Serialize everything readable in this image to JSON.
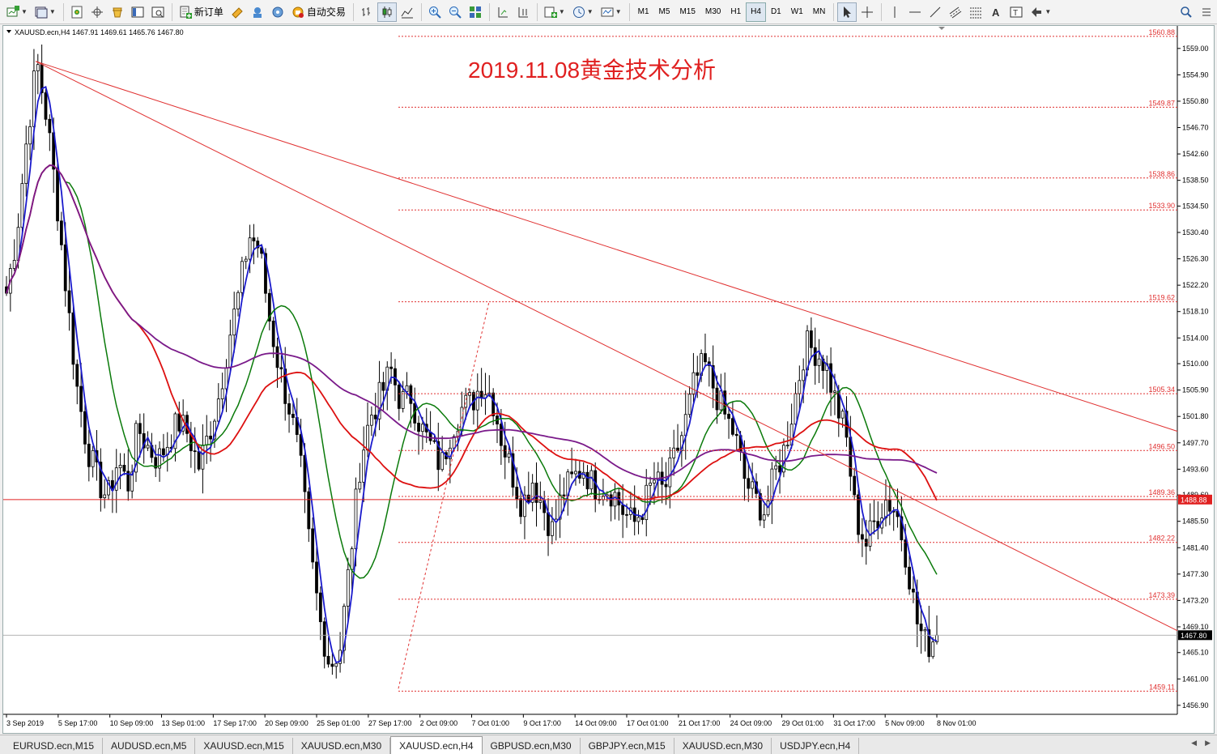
{
  "window": {
    "title": "XAUUSD.ecn,H4"
  },
  "toolbar": {
    "new_order_label": "新订单",
    "autotrade_label": "自动交易",
    "timeframes": [
      "M1",
      "M5",
      "M15",
      "M30",
      "H1",
      "H4",
      "D1",
      "W1",
      "MN"
    ],
    "active_timeframe": "H4",
    "icons": [
      "new-chart-icon",
      "profiles-icon",
      "market-watch-icon",
      "navigator-icon",
      "data-window-icon",
      "terminal-icon",
      "strategy-tester-icon",
      "new-order-icon",
      "metaeditor-icon",
      "metaquotes-icon",
      "signals-icon",
      "autotrade-icon",
      "bar-chart-icon",
      "candles-icon",
      "line-chart-icon",
      "zoom-in-icon",
      "zoom-out-icon",
      "tile-icon",
      "autoscroll-icon",
      "chart-shift-icon",
      "indicators-icon",
      "period-icon",
      "templates-icon",
      "cursor-icon",
      "crosshair-icon",
      "vertical-line-icon",
      "horizontal-line-icon",
      "trendline-icon",
      "equidistant-channel-icon",
      "fibonacci-icon",
      "text-icon",
      "text-label-icon",
      "arrows-icon",
      "search-icon"
    ],
    "accent": "#1e5fb4"
  },
  "chart": {
    "header": "XAUUSD.ecn,H4  1467.91 1469.61 1465.76 1467.80",
    "annotation": "2019.11.08黄金技术分析",
    "annotation_color": "#e02020",
    "current_price": "1467.80",
    "hline_price": "1488.88",
    "colors": {
      "bg": "#ffffff",
      "candle": "#000000",
      "ma_fast": "#1a1acc",
      "ma_mid": "#0a7a0a",
      "ma_slow": "#dd1010",
      "ma_long": "#7a1a8a",
      "level": "#e03030",
      "price_tag": "#e02020"
    }
  },
  "chart_data": {
    "type": "candlestick",
    "symbol": "XAUUSD.ecn",
    "timeframe": "H4",
    "ohlc": {
      "open": 1467.91,
      "high": 1469.61,
      "low": 1465.76,
      "close": 1467.8
    },
    "ylim": [
      1455.5,
      1562.5
    ],
    "yticks": [
      "1559.00",
      "1554.90",
      "1550.80",
      "1546.70",
      "1542.60",
      "1538.50",
      "1534.50",
      "1530.40",
      "1526.30",
      "1522.20",
      "1518.10",
      "1514.00",
      "1510.00",
      "1505.90",
      "1501.80",
      "1497.70",
      "1493.60",
      "1489.60",
      "1485.50",
      "1481.40",
      "1477.30",
      "1473.20",
      "1469.10",
      "1465.10",
      "1461.00",
      "1456.90"
    ],
    "levels": [
      "1560.88",
      "1549.87",
      "1538.86",
      "1533.90",
      "1519.62",
      "1505.34",
      "1496.50",
      "1489.36",
      "1482.22",
      "1473.39",
      "1459.11"
    ],
    "xlabels": [
      "3 Sep 2019",
      "5 Sep 17:00",
      "10 Sep 09:00",
      "13 Sep 01:00",
      "17 Sep 17:00",
      "20 Sep 09:00",
      "25 Sep 01:00",
      "27 Sep 17:00",
      "2 Oct 09:00",
      "7 Oct 01:00",
      "9 Oct 17:00",
      "14 Oct 09:00",
      "17 Oct 01:00",
      "21 Oct 17:00",
      "24 Oct 09:00",
      "29 Oct 01:00",
      "31 Oct 17:00",
      "5 Nov 09:00",
      "8 Nov 01:00"
    ],
    "price_path": [
      1521,
      1530,
      1545,
      1557,
      1548,
      1535,
      1520,
      1506,
      1497,
      1492,
      1489,
      1495,
      1491,
      1500,
      1497,
      1495,
      1498,
      1501,
      1499,
      1494,
      1499,
      1505,
      1514,
      1521,
      1530,
      1528,
      1517,
      1509,
      1503,
      1495,
      1481,
      1470,
      1463,
      1466,
      1480,
      1495,
      1502,
      1505,
      1509,
      1504,
      1505,
      1500,
      1497,
      1494,
      1500,
      1503,
      1504,
      1507,
      1505,
      1498,
      1493,
      1488,
      1492,
      1488,
      1484,
      1490,
      1492,
      1494,
      1491,
      1491,
      1490,
      1487,
      1485,
      1488,
      1492,
      1490,
      1495,
      1500,
      1507,
      1510,
      1506,
      1502,
      1499,
      1492,
      1489,
      1487,
      1493,
      1497,
      1505,
      1513,
      1512,
      1510,
      1504,
      1499,
      1486,
      1482,
      1486,
      1489,
      1487,
      1480,
      1470,
      1466,
      1468
    ]
  },
  "tabs": [
    {
      "label": "EURUSD.ecn,M15",
      "active": false
    },
    {
      "label": "AUDUSD.ecn,M5",
      "active": false
    },
    {
      "label": "XAUUSD.ecn,M15",
      "active": false
    },
    {
      "label": "XAUUSD.ecn,M30",
      "active": false
    },
    {
      "label": "XAUUSD.ecn,H4",
      "active": true
    },
    {
      "label": "GBPUSD.ecn,M30",
      "active": false
    },
    {
      "label": "GBPJPY.ecn,M15",
      "active": false
    },
    {
      "label": "XAUUSD.ecn,M30",
      "active": false
    },
    {
      "label": "USDJPY.ecn,H4",
      "active": false
    }
  ]
}
